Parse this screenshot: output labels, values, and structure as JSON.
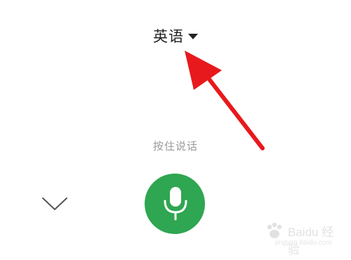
{
  "language_selector": {
    "label": "英语",
    "caret_icon": "caret-down-icon"
  },
  "annotation": {
    "icon": "red-arrow-annotation",
    "color": "#e8191c"
  },
  "voice_input": {
    "hint": "按住说话",
    "mic_icon": "microphone-icon",
    "mic_color": "#2fa651",
    "collapse_icon": "chevron-down-icon"
  },
  "watermark": {
    "text": "Baidu 经验",
    "sub": "jingyan.baidu.com"
  }
}
